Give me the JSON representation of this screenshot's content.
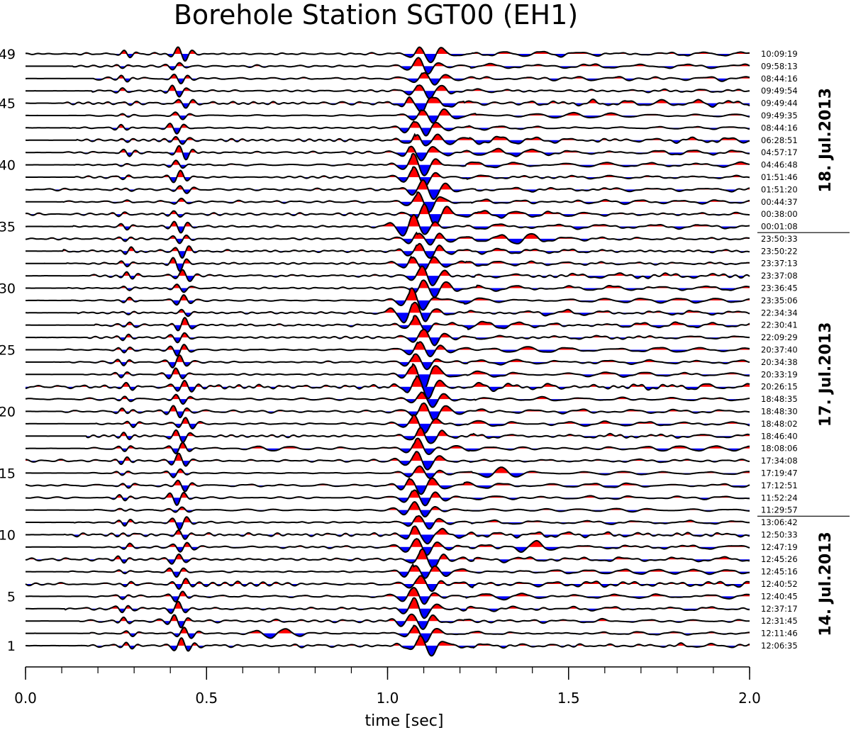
{
  "chart_data": {
    "type": "line",
    "title": "Borehole Station SGT00 (EH1)",
    "xlabel": "time [sec]",
    "xlim": [
      0.0,
      2.0
    ],
    "x_ticks": [
      {
        "value": 0.0,
        "label": "0.0"
      },
      {
        "value": 0.5,
        "label": "0.5"
      },
      {
        "value": 1.0,
        "label": "1.0"
      },
      {
        "value": 1.5,
        "label": "1.5"
      },
      {
        "value": 2.0,
        "label": "2.0"
      }
    ],
    "x_minor_step": 0.1,
    "trace_count": 49,
    "trace_labels": [
      {
        "trace": 1,
        "label": "1"
      },
      {
        "trace": 5,
        "label": "5"
      },
      {
        "trace": 10,
        "label": "10"
      },
      {
        "trace": 15,
        "label": "15"
      },
      {
        "trace": 20,
        "label": "20"
      },
      {
        "trace": 25,
        "label": "25"
      },
      {
        "trace": 30,
        "label": "30"
      },
      {
        "trace": 35,
        "label": "35"
      },
      {
        "trace": 40,
        "label": "40"
      },
      {
        "trace": 45,
        "label": "45"
      },
      {
        "trace": 49,
        "label": "49"
      }
    ],
    "event_times_top_to_bottom": [
      "10:09:19",
      "09:58:13",
      "08:44:16",
      "09:49:54",
      "09:49:44",
      "09:49:35",
      "08:44:16",
      "06:28:51",
      "04:57:17",
      "04:46:48",
      "01:51:46",
      "01:51:20",
      "00:44:37",
      "00:38:00",
      "00:01:08",
      "23:50:33",
      "23:50:22",
      "23:37:13",
      "23:37:08",
      "23:36:45",
      "23:35:06",
      "22:34:34",
      "22:30:41",
      "22:09:29",
      "20:37:40",
      "20:34:38",
      "20:33:19",
      "20:26:15",
      "18:48:35",
      "18:48:30",
      "18:48:02",
      "18:46:40",
      "18:08:06",
      "17:34:08",
      "17:19:47",
      "17:12:51",
      "11:52:24",
      "11:29:57",
      "13:06:42",
      "12:50:33",
      "12:47:19",
      "12:45:26",
      "12:45:16",
      "12:40:52",
      "12:40:45",
      "12:37:17",
      "12:31:45",
      "12:11:46",
      "12:06:35"
    ],
    "date_groups": [
      {
        "label": "18. Jul.2013",
        "count": 15
      },
      {
        "label": "17. Jul.2013",
        "count": 23
      },
      {
        "label": "14. Jul.2013",
        "count": 11
      }
    ],
    "fill_colors": {
      "positive": "#ff0000",
      "negative": "#0000ff"
    },
    "line_color": "#000000"
  }
}
